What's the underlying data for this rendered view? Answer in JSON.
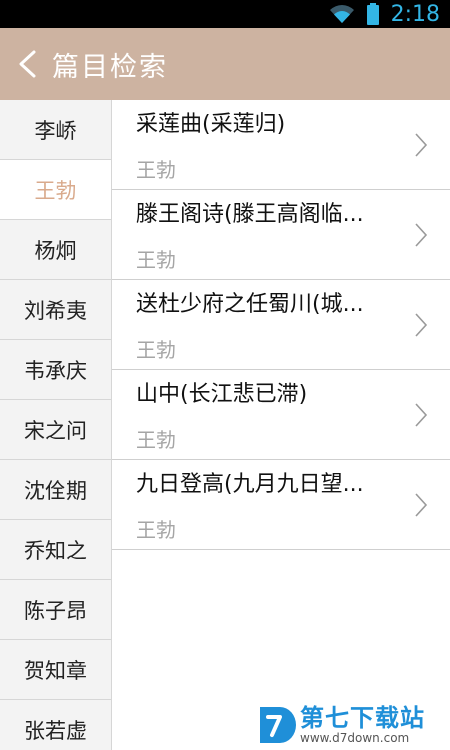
{
  "status_bar": {
    "time": "2:18"
  },
  "header": {
    "title": "篇目检索"
  },
  "sidebar": {
    "items": [
      {
        "label": "李峤"
      },
      {
        "label": "王勃"
      },
      {
        "label": "杨炯"
      },
      {
        "label": "刘希夷"
      },
      {
        "label": "韦承庆"
      },
      {
        "label": "宋之问"
      },
      {
        "label": "沈佺期"
      },
      {
        "label": "乔知之"
      },
      {
        "label": "陈子昂"
      },
      {
        "label": "贺知章"
      },
      {
        "label": "张若虚"
      }
    ],
    "selected_label": "王勃"
  },
  "poems": [
    {
      "title": "采莲曲(采莲归)",
      "author": "王勃"
    },
    {
      "title": "滕王阁诗(滕王高阁临...",
      "author": "王勃"
    },
    {
      "title": "送杜少府之任蜀川(城...",
      "author": "王勃"
    },
    {
      "title": "山中(长江悲已滞)",
      "author": "王勃"
    },
    {
      "title": "九日登高(九月九日望...",
      "author": "王勃"
    }
  ],
  "watermark": {
    "name": "第七下载站",
    "url": "www.d7down.com"
  },
  "colors": {
    "header_bg": "#cdb3a1",
    "active_sidebar_text": "#d9aa8c",
    "status_accent": "#33b5e5",
    "watermark_blue": "#1f8fd8"
  }
}
